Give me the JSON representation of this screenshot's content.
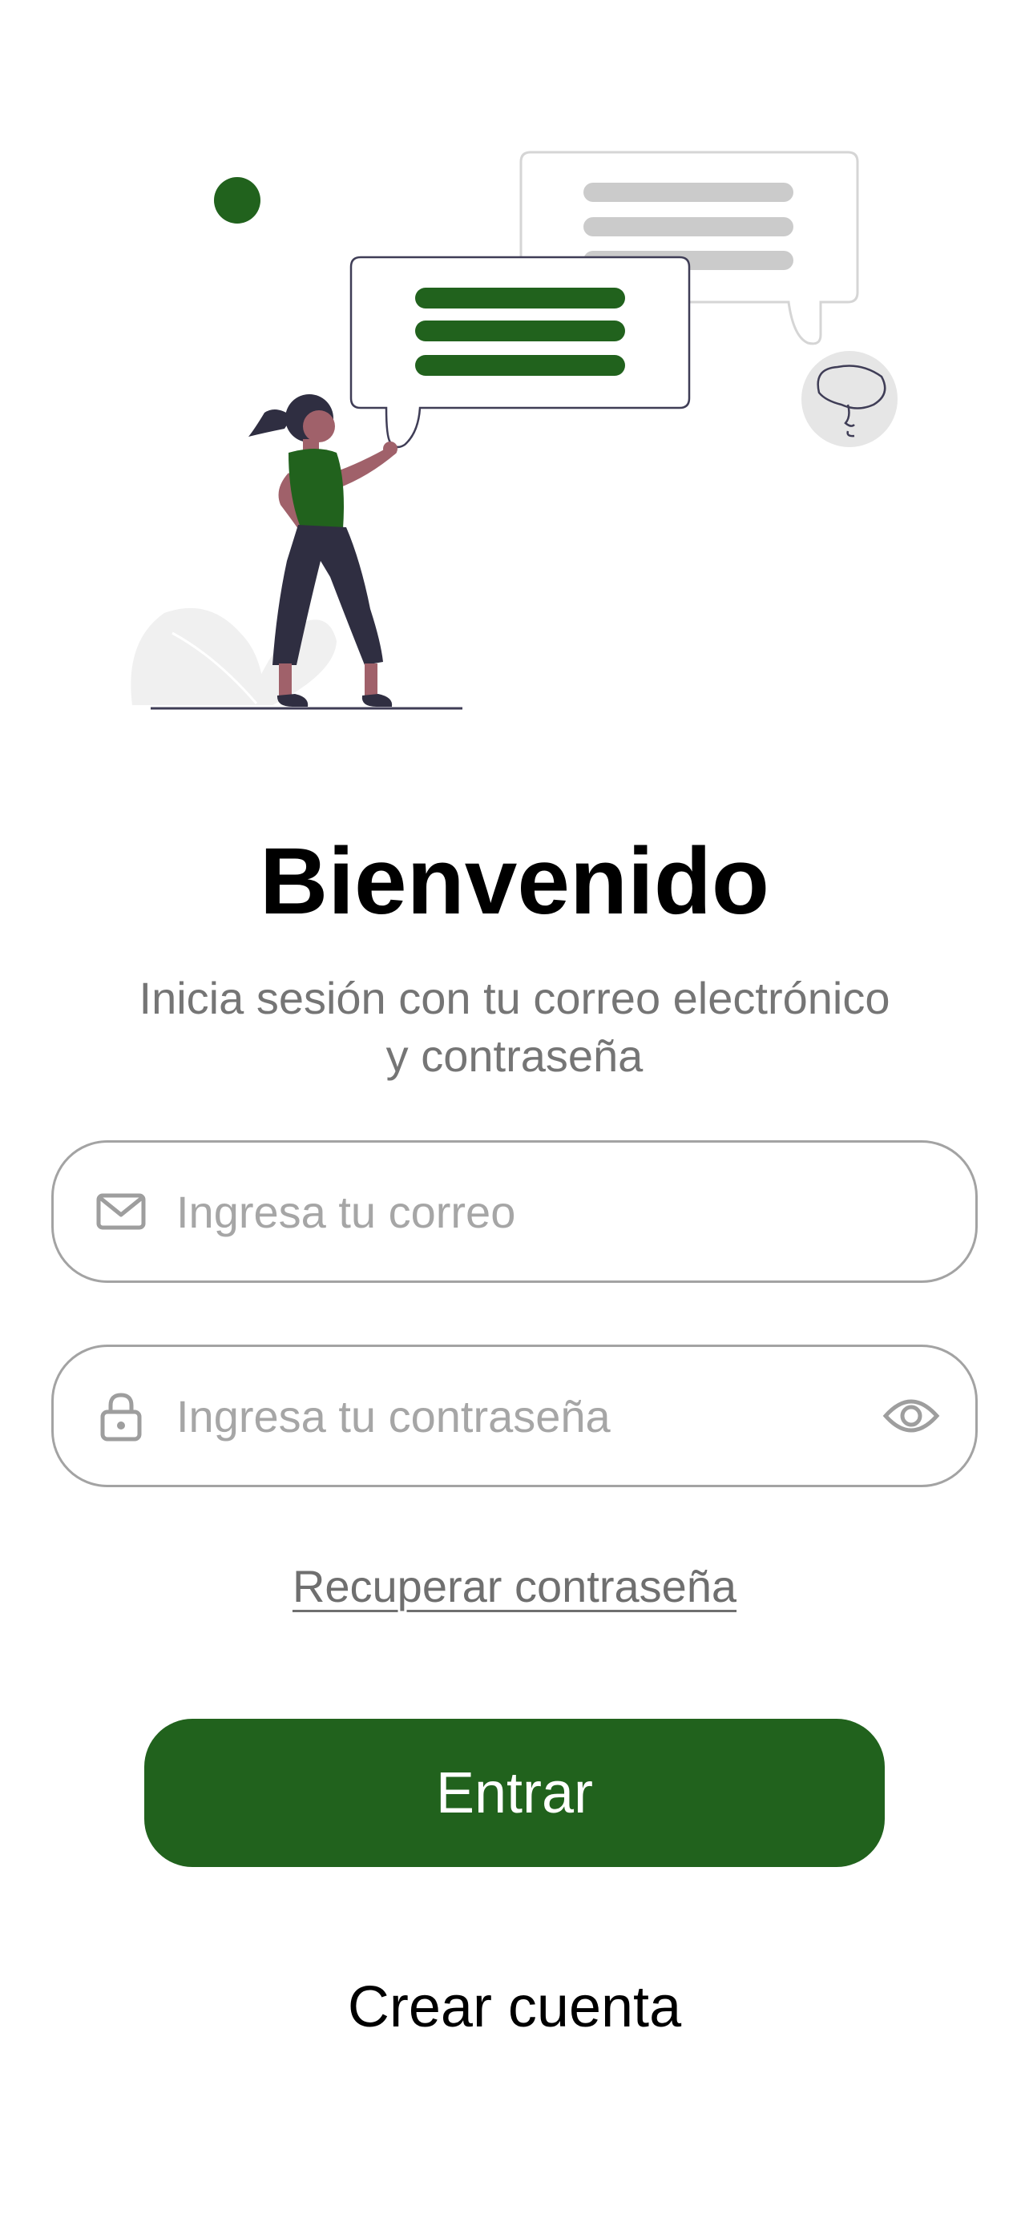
{
  "welcome": {
    "title": "Bienvenido",
    "subtitle_line1": "Inicia sesión con tu correo electrónico",
    "subtitle_line2": "y contraseña"
  },
  "form": {
    "email": {
      "icon": "mail-icon",
      "placeholder": "Ingresa tu correo",
      "value": ""
    },
    "password": {
      "icon": "lock-icon",
      "placeholder": "Ingresa tu contraseña",
      "value": "",
      "toggle_icon": "eye-icon"
    },
    "recover_label": "Recuperar contraseña",
    "submit_label": "Entrar",
    "create_account_label": "Crear cuenta"
  },
  "colors": {
    "accent": "#21621d",
    "placeholder": "#a6a6a6",
    "subtitle": "#757575",
    "border": "#a3a3a3"
  }
}
